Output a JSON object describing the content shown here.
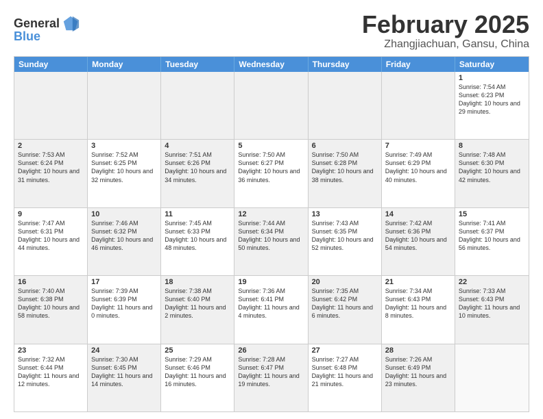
{
  "logo": {
    "text_general": "General",
    "text_blue": "Blue"
  },
  "title": "February 2025",
  "subtitle": "Zhangjiachuan, Gansu, China",
  "header_days": [
    "Sunday",
    "Monday",
    "Tuesday",
    "Wednesday",
    "Thursday",
    "Friday",
    "Saturday"
  ],
  "weeks": [
    [
      {
        "day": "",
        "info": "",
        "shaded": true
      },
      {
        "day": "",
        "info": "",
        "shaded": true
      },
      {
        "day": "",
        "info": "",
        "shaded": true
      },
      {
        "day": "",
        "info": "",
        "shaded": true
      },
      {
        "day": "",
        "info": "",
        "shaded": true
      },
      {
        "day": "",
        "info": "",
        "shaded": true
      },
      {
        "day": "1",
        "info": "Sunrise: 7:54 AM\nSunset: 6:23 PM\nDaylight: 10 hours and 29 minutes.",
        "shaded": false
      }
    ],
    [
      {
        "day": "2",
        "info": "Sunrise: 7:53 AM\nSunset: 6:24 PM\nDaylight: 10 hours and 31 minutes.",
        "shaded": true
      },
      {
        "day": "3",
        "info": "Sunrise: 7:52 AM\nSunset: 6:25 PM\nDaylight: 10 hours and 32 minutes.",
        "shaded": false
      },
      {
        "day": "4",
        "info": "Sunrise: 7:51 AM\nSunset: 6:26 PM\nDaylight: 10 hours and 34 minutes.",
        "shaded": true
      },
      {
        "day": "5",
        "info": "Sunrise: 7:50 AM\nSunset: 6:27 PM\nDaylight: 10 hours and 36 minutes.",
        "shaded": false
      },
      {
        "day": "6",
        "info": "Sunrise: 7:50 AM\nSunset: 6:28 PM\nDaylight: 10 hours and 38 minutes.",
        "shaded": true
      },
      {
        "day": "7",
        "info": "Sunrise: 7:49 AM\nSunset: 6:29 PM\nDaylight: 10 hours and 40 minutes.",
        "shaded": false
      },
      {
        "day": "8",
        "info": "Sunrise: 7:48 AM\nSunset: 6:30 PM\nDaylight: 10 hours and 42 minutes.",
        "shaded": true
      }
    ],
    [
      {
        "day": "9",
        "info": "Sunrise: 7:47 AM\nSunset: 6:31 PM\nDaylight: 10 hours and 44 minutes.",
        "shaded": false
      },
      {
        "day": "10",
        "info": "Sunrise: 7:46 AM\nSunset: 6:32 PM\nDaylight: 10 hours and 46 minutes.",
        "shaded": true
      },
      {
        "day": "11",
        "info": "Sunrise: 7:45 AM\nSunset: 6:33 PM\nDaylight: 10 hours and 48 minutes.",
        "shaded": false
      },
      {
        "day": "12",
        "info": "Sunrise: 7:44 AM\nSunset: 6:34 PM\nDaylight: 10 hours and 50 minutes.",
        "shaded": true
      },
      {
        "day": "13",
        "info": "Sunrise: 7:43 AM\nSunset: 6:35 PM\nDaylight: 10 hours and 52 minutes.",
        "shaded": false
      },
      {
        "day": "14",
        "info": "Sunrise: 7:42 AM\nSunset: 6:36 PM\nDaylight: 10 hours and 54 minutes.",
        "shaded": true
      },
      {
        "day": "15",
        "info": "Sunrise: 7:41 AM\nSunset: 6:37 PM\nDaylight: 10 hours and 56 minutes.",
        "shaded": false
      }
    ],
    [
      {
        "day": "16",
        "info": "Sunrise: 7:40 AM\nSunset: 6:38 PM\nDaylight: 10 hours and 58 minutes.",
        "shaded": true
      },
      {
        "day": "17",
        "info": "Sunrise: 7:39 AM\nSunset: 6:39 PM\nDaylight: 11 hours and 0 minutes.",
        "shaded": false
      },
      {
        "day": "18",
        "info": "Sunrise: 7:38 AM\nSunset: 6:40 PM\nDaylight: 11 hours and 2 minutes.",
        "shaded": true
      },
      {
        "day": "19",
        "info": "Sunrise: 7:36 AM\nSunset: 6:41 PM\nDaylight: 11 hours and 4 minutes.",
        "shaded": false
      },
      {
        "day": "20",
        "info": "Sunrise: 7:35 AM\nSunset: 6:42 PM\nDaylight: 11 hours and 6 minutes.",
        "shaded": true
      },
      {
        "day": "21",
        "info": "Sunrise: 7:34 AM\nSunset: 6:43 PM\nDaylight: 11 hours and 8 minutes.",
        "shaded": false
      },
      {
        "day": "22",
        "info": "Sunrise: 7:33 AM\nSunset: 6:43 PM\nDaylight: 11 hours and 10 minutes.",
        "shaded": true
      }
    ],
    [
      {
        "day": "23",
        "info": "Sunrise: 7:32 AM\nSunset: 6:44 PM\nDaylight: 11 hours and 12 minutes.",
        "shaded": false
      },
      {
        "day": "24",
        "info": "Sunrise: 7:30 AM\nSunset: 6:45 PM\nDaylight: 11 hours and 14 minutes.",
        "shaded": true
      },
      {
        "day": "25",
        "info": "Sunrise: 7:29 AM\nSunset: 6:46 PM\nDaylight: 11 hours and 16 minutes.",
        "shaded": false
      },
      {
        "day": "26",
        "info": "Sunrise: 7:28 AM\nSunset: 6:47 PM\nDaylight: 11 hours and 19 minutes.",
        "shaded": true
      },
      {
        "day": "27",
        "info": "Sunrise: 7:27 AM\nSunset: 6:48 PM\nDaylight: 11 hours and 21 minutes.",
        "shaded": false
      },
      {
        "day": "28",
        "info": "Sunrise: 7:26 AM\nSunset: 6:49 PM\nDaylight: 11 hours and 23 minutes.",
        "shaded": true
      },
      {
        "day": "",
        "info": "",
        "shaded": false
      }
    ]
  ]
}
